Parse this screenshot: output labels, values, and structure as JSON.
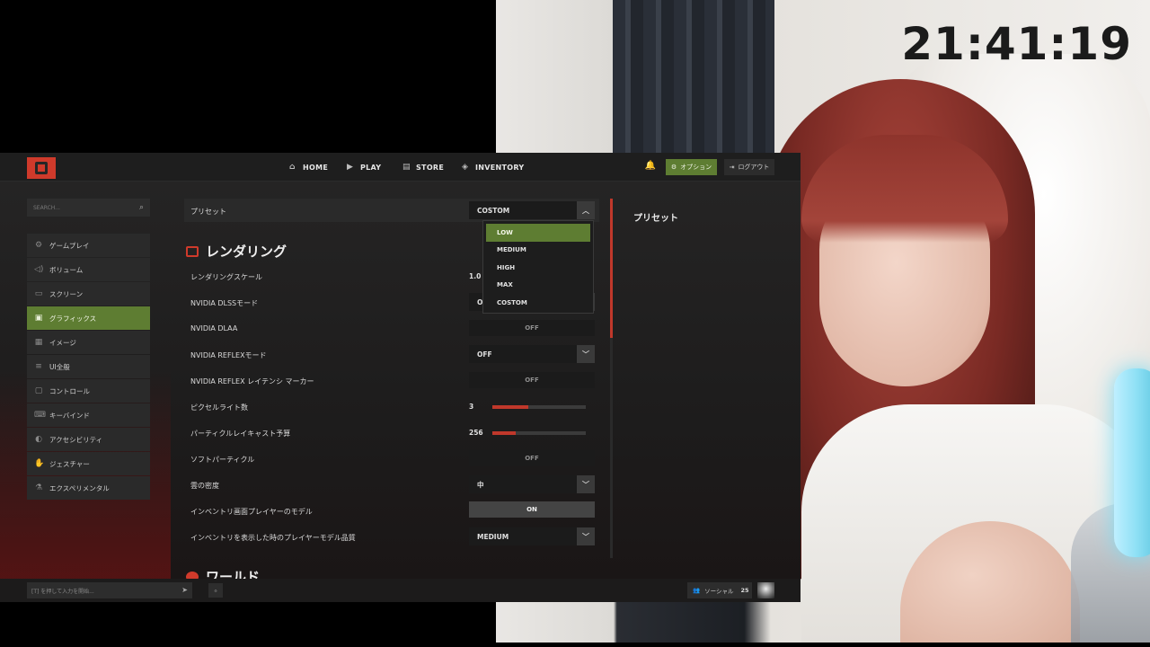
{
  "clock": "21:41:19",
  "topbar": {
    "nav": [
      {
        "label": "HOME",
        "icon": "home-icon"
      },
      {
        "label": "PLAY",
        "icon": "play-icon"
      },
      {
        "label": "STORE",
        "icon": "store-icon"
      },
      {
        "label": "INVENTORY",
        "icon": "inventory-icon"
      }
    ],
    "options_label": "オプション",
    "logout_label": "ログアウト"
  },
  "sidebar": {
    "search_placeholder": "SEARCH...",
    "items": [
      {
        "label": "ゲームプレイ",
        "icon": "gear-icon"
      },
      {
        "label": "ボリューム",
        "icon": "speaker-icon"
      },
      {
        "label": "スクリーン",
        "icon": "monitor-icon"
      },
      {
        "label": "グラフィックス",
        "icon": "graphics-icon",
        "active": true
      },
      {
        "label": "イメージ",
        "icon": "image-icon"
      },
      {
        "label": "UI全般",
        "icon": "ui-icon"
      },
      {
        "label": "コントロール",
        "icon": "mouse-icon"
      },
      {
        "label": "キーバインド",
        "icon": "keyboard-icon"
      },
      {
        "label": "アクセシビリティ",
        "icon": "accessibility-icon"
      },
      {
        "label": "ジェスチャー",
        "icon": "gesture-icon"
      },
      {
        "label": "エクスペリメンタル",
        "icon": "flask-icon"
      }
    ]
  },
  "settings": {
    "preset": {
      "label": "プリセット",
      "value": "COSTOM"
    },
    "preset_options": [
      "LOW",
      "MEDIUM",
      "HIGH",
      "MAX",
      "COSTOM"
    ],
    "rendering_title": "レンダリング",
    "world_title": "ワールド",
    "rows": {
      "render_scale": {
        "label": "レンダリングスケール",
        "value": "1.0"
      },
      "dlss": {
        "label": "NVIDIA DLSSモード",
        "value": "OFF"
      },
      "dlaa": {
        "label": "NVIDIA DLAA",
        "value": "OFF"
      },
      "reflex": {
        "label": "NVIDIA REFLEXモード",
        "value": "OFF"
      },
      "reflex_marker": {
        "label": "NVIDIA REFLEX レイテンシ マーカー",
        "value": "OFF"
      },
      "pixel_lights": {
        "label": "ピクセルライト数",
        "value": "3",
        "fraction": 0.38
      },
      "particle_budget": {
        "label": "パーティクルレイキャスト予算",
        "value": "256",
        "fraction": 0.25
      },
      "soft_particles": {
        "label": "ソフトパーティクル",
        "value": "OFF"
      },
      "cloud_density": {
        "label": "雲の密度",
        "value": "中"
      },
      "inventory_model": {
        "label": "インベントリ画面プレイヤーのモデル",
        "value": "ON"
      },
      "inventory_quality": {
        "label": "インベントリを表示した時のプレイヤーモデル品質",
        "value": "MEDIUM"
      }
    }
  },
  "info_panel": {
    "title": "プリセット"
  },
  "bottombar": {
    "chat_placeholder": "[T] を押して入力を開始...",
    "social_label": "ソーシャル",
    "social_count": "25"
  },
  "colors": {
    "accent_green": "#5e7d32",
    "accent_red": "#c0382b"
  }
}
